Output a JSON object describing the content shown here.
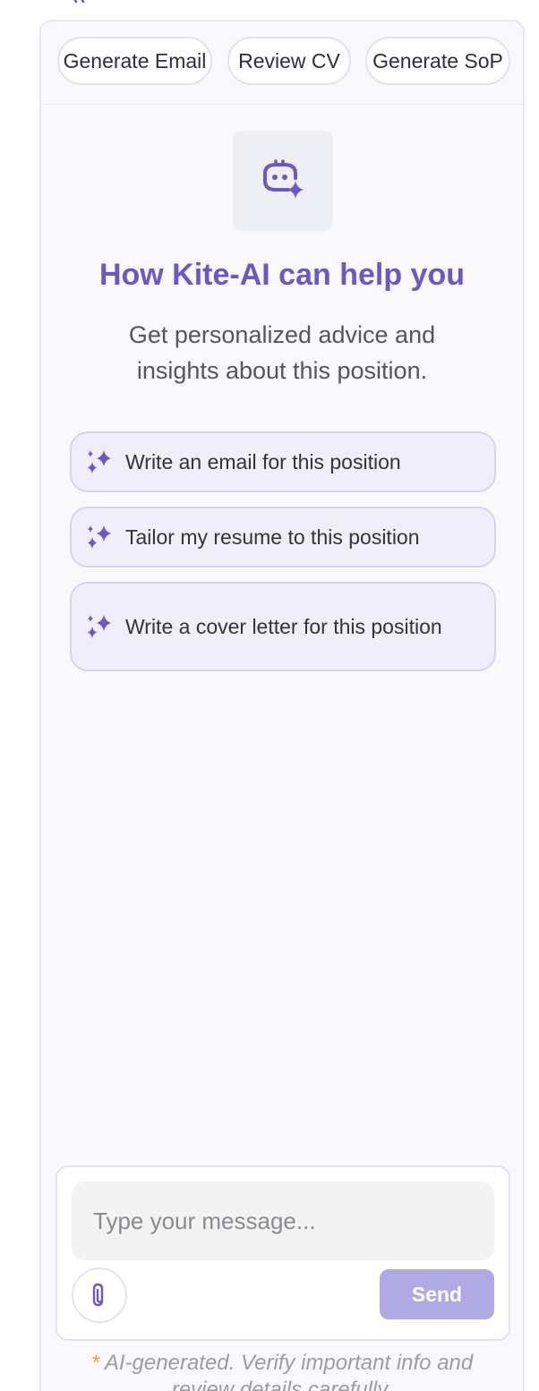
{
  "quick_actions": [
    {
      "label": "Generate Email"
    },
    {
      "label": "Review CV"
    },
    {
      "label": "Generate SoP"
    }
  ],
  "hero": {
    "icon": "bot-sparkle-icon",
    "title": "How Kite-AI can help you",
    "subtitle": "Get personalized advice and insights about this position."
  },
  "suggestions": [
    {
      "label": "Write an email for this position",
      "icon": "sparkles-icon"
    },
    {
      "label": "Tailor my resume to this position",
      "icon": "sparkles-icon"
    },
    {
      "label": "Write a cover letter for this position",
      "icon": "sparkles-icon"
    }
  ],
  "composer": {
    "placeholder": "Type your message...",
    "value": "",
    "attach_icon": "paperclip-icon",
    "send_label": "Send"
  },
  "disclaimer": {
    "marker": "*",
    "text": "AI-generated. Verify important info and review details carefully."
  },
  "colors": {
    "accent": "#6a58c4",
    "send_disabled": "#b1a9e3",
    "panel_bg": "#f8f8fd",
    "suggestion_bg": "#f0eef9",
    "asterisk": "#f0a43a"
  }
}
